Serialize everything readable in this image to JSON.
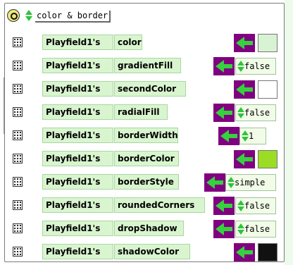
{
  "header": {
    "label": "color & border"
  },
  "owner_label": "Playfield1's",
  "rows": [
    {
      "property": "color",
      "kind": "color",
      "value_color": "#d7f3d3"
    },
    {
      "property": "gradientFill",
      "kind": "value",
      "value": "false"
    },
    {
      "property": "secondColor",
      "kind": "color",
      "value_color": "#ffffff"
    },
    {
      "property": "radialFill",
      "kind": "value",
      "value": "false"
    },
    {
      "property": "borderWidth",
      "kind": "value",
      "value": "1"
    },
    {
      "property": "borderColor",
      "kind": "color",
      "value_color": "#9bdc25"
    },
    {
      "property": "borderStyle",
      "kind": "value",
      "value": "simple"
    },
    {
      "property": "roundedCorners",
      "kind": "value",
      "value": "false"
    },
    {
      "property": "dropShadow",
      "kind": "value",
      "value": "false"
    },
    {
      "property": "shadowColor",
      "kind": "color",
      "value_color": "#111111"
    }
  ],
  "colors": {
    "tile_green": "#d9f5cf",
    "assign_purple": "#800080",
    "arrow_green": "#36d13e"
  }
}
